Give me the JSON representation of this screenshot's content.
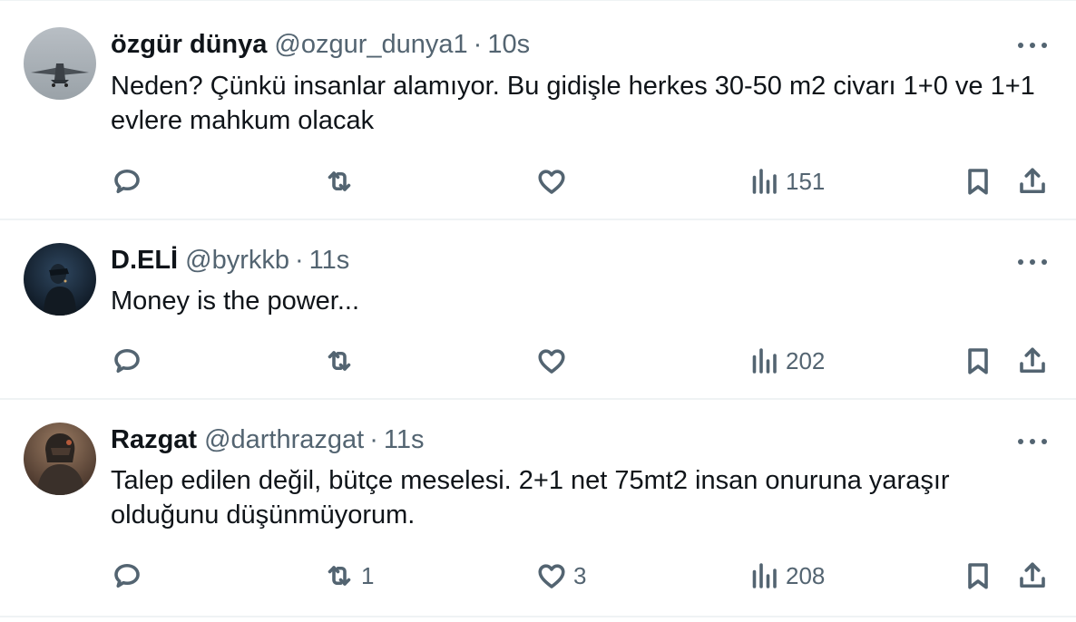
{
  "tweets": [
    {
      "name": "özgür dünya",
      "handle": "@ozgur_dunya1",
      "separator": "·",
      "time": "10s",
      "text": "Neden? Çünkü insanlar alamıyor. Bu gidişle herkes 30-50 m2 civarı 1+0 ve 1+1 evlere mahkum olacak",
      "replies": "",
      "reposts": "",
      "likes": "",
      "views": "151"
    },
    {
      "name": "D.ELİ",
      "handle": "@byrkkb",
      "separator": "·",
      "time": "11s",
      "text": "Money is the power...",
      "replies": "",
      "reposts": "",
      "likes": "",
      "views": "202"
    },
    {
      "name": "Razgat",
      "handle": "@darthrazgat",
      "separator": "·",
      "time": "11s",
      "text": "Talep edilen değil, bütçe meselesi. 2+1 net 75mt2 insan onuruna yaraşır olduğunu düşünmüyorum.",
      "replies": "",
      "reposts": "1",
      "likes": "3",
      "views": "208"
    }
  ],
  "colors": {
    "text": "#0f1419",
    "secondary": "#536471",
    "divider": "#eff3f4"
  },
  "icons": [
    "reply-icon",
    "repost-icon",
    "like-icon",
    "views-icon",
    "bookmark-icon",
    "share-icon",
    "more-icon"
  ]
}
